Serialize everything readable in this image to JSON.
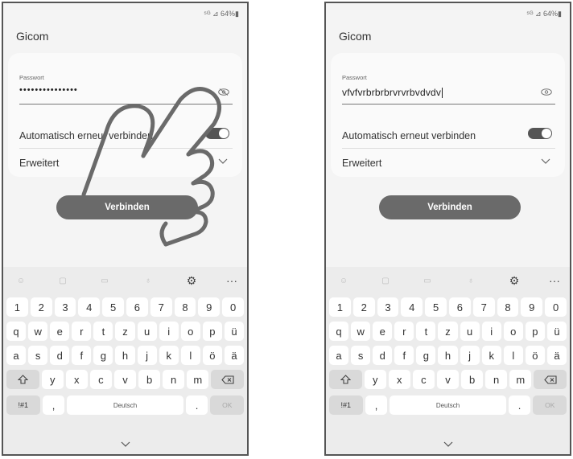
{
  "left": {
    "status": "⁵ᴳ ⊿ 64%▮",
    "app_title": "Gicom",
    "password_label": "Passwort",
    "password_value": "•••••••••••••••",
    "auto_reconnect_label": "Automatisch erneut verbinden",
    "advanced_label": "Erweitert",
    "connect_label": "Verbinden",
    "auto_reconnect_on": true
  },
  "right": {
    "status": "⁵ᴳ ⊿ 64%▮",
    "app_title": "Gicom",
    "password_label": "Passwort",
    "password_value": "vfvfvrbrbrbrvrvrbvdvdv",
    "auto_reconnect_label": "Automatisch erneut verbinden",
    "advanced_label": "Erweitert",
    "connect_label": "Verbinden",
    "auto_reconnect_on": true
  },
  "keyboard": {
    "toolbar_icons": [
      "emoji-icon",
      "sticker-icon",
      "gif-icon",
      "mic-icon",
      "settings-icon",
      "more-icon"
    ],
    "row_numbers": [
      "1",
      "2",
      "3",
      "4",
      "5",
      "6",
      "7",
      "8",
      "9",
      "0"
    ],
    "row_1": [
      "q",
      "w",
      "e",
      "r",
      "t",
      "z",
      "u",
      "i",
      "o",
      "p",
      "ü"
    ],
    "row_2": [
      "a",
      "s",
      "d",
      "f",
      "g",
      "h",
      "j",
      "k",
      "l",
      "ö",
      "ä"
    ],
    "row_3": [
      "y",
      "x",
      "c",
      "v",
      "b",
      "n",
      "m"
    ],
    "symbols_label": "!#1",
    "comma_label": ",",
    "space_label": "Deutsch",
    "period_label": ".",
    "ok_label": "OK"
  }
}
